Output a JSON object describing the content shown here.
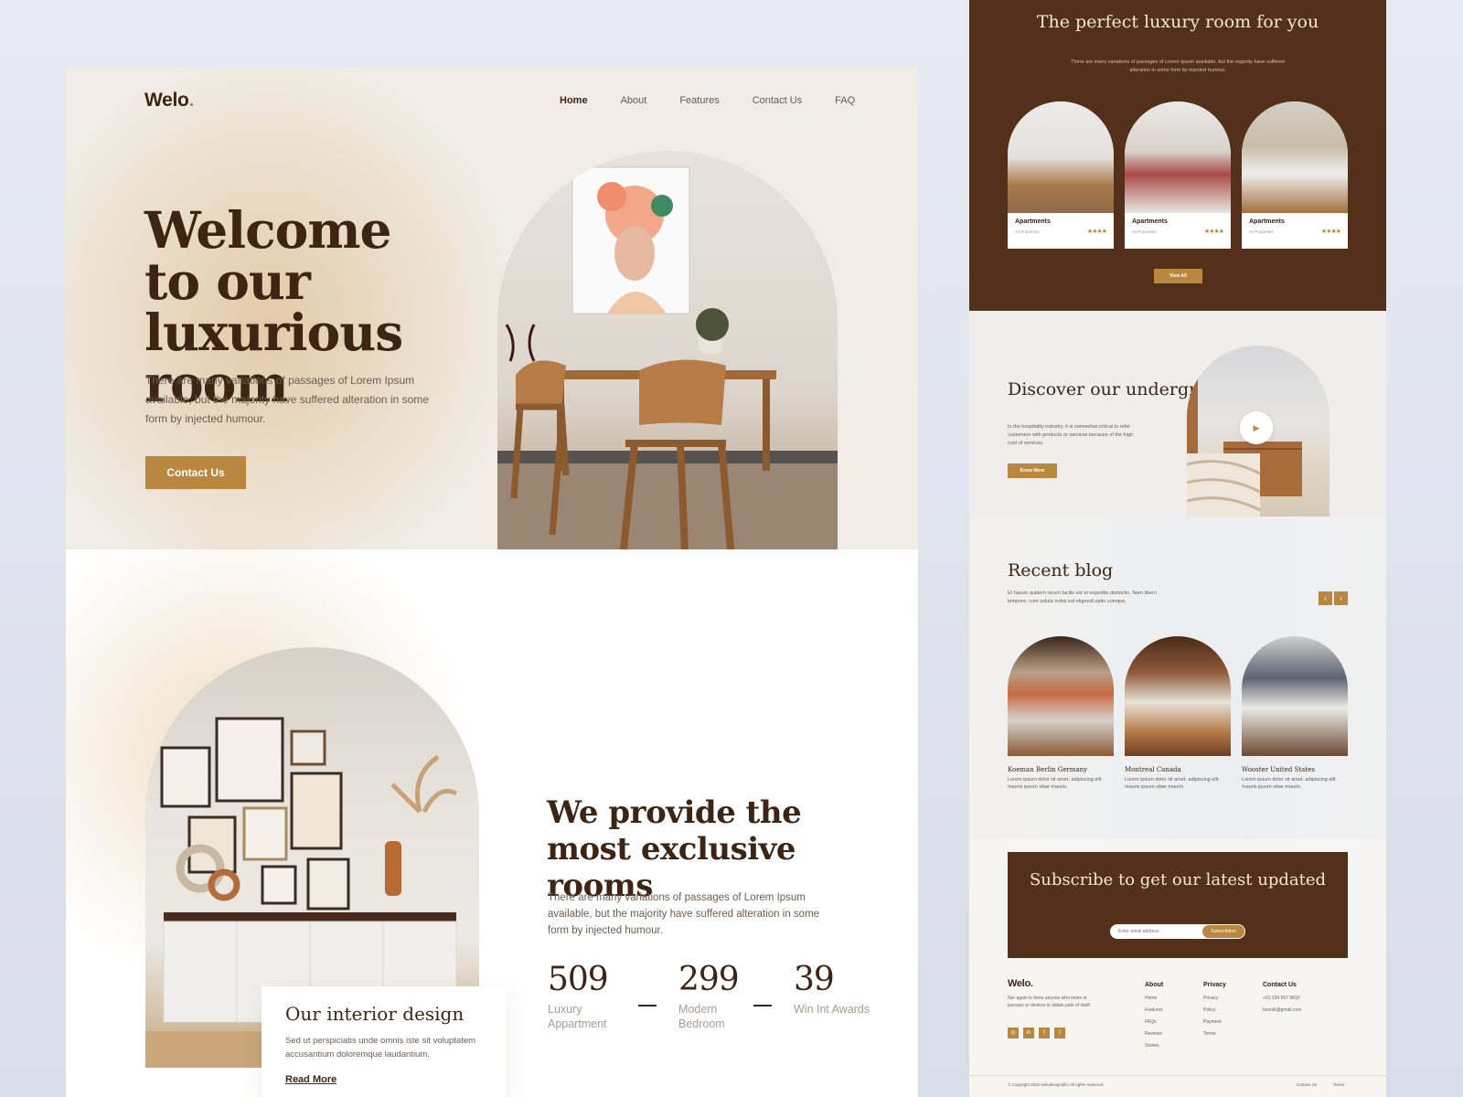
{
  "landing": {
    "logo": "Welo",
    "logo_dot": ".",
    "nav": [
      "Home",
      "About",
      "Features",
      "Contact Us",
      "FAQ"
    ],
    "hero": {
      "title": "Welcome to our luxurious room",
      "description": "There are many variations of passages of Lorem Ipsum available, but the majority have suffered alteration in some form by injected humour.",
      "cta": "Contact Us"
    },
    "about": {
      "title": "We provide the most exclusive rooms",
      "description": "There are many variations of passages of Lorem Ipsum available, but the majority have suffered alteration in some form by injected humour.",
      "card_title": "Our interior design",
      "card_desc": "Sed ut perspiciatis unde omnis iste sit voluptatem accusantium doloremque laudantium.",
      "card_link": "Read More",
      "stats": [
        {
          "number": "509",
          "label": "Luxury Appartment"
        },
        {
          "number": "299",
          "label": "Modern Bedroom"
        },
        {
          "number": "39",
          "label": "Win Int Awards"
        }
      ]
    }
  },
  "detail": {
    "rooms": {
      "title": "The perfect luxury room for you",
      "description": "There are many variations of passages of Lorem Ipsum available, but the majority have suffered alteration in some form by injected humour.",
      "cards": [
        {
          "name": "Apartments",
          "count": "43 Properties",
          "stars": "★★★★"
        },
        {
          "name": "Apartments",
          "count": "43 Properties",
          "stars": "★★★★"
        },
        {
          "name": "Apartments",
          "count": "43 Properties",
          "stars": "★★★★"
        }
      ],
      "button": "View All"
    },
    "discover": {
      "title": "Discover our underground",
      "description": "In the hospitality industry, it is somewhat critical to refer customers with products or services because of the high cost of services.",
      "button": "Know More",
      "play_icon": "▶"
    },
    "blog": {
      "title": "Recent blog",
      "description": "Et harum quidem rerum facilis est et expedita distinctio. Nam libero tempore, cum soluta nobis est eligendi optio cumque.",
      "prev": "‹",
      "next": "›",
      "posts": [
        {
          "location": "Koeman Berlin Germany",
          "text": "Lorem ipsum dolor sit amet, adipiscing elit mauris ipsum vitae mauris."
        },
        {
          "location": "Montreal Canada",
          "text": "Lorem ipsum dolor sit amet, adipiscing elit mauris ipsum vitae mauris."
        },
        {
          "location": "Wooster United States",
          "text": "Lorem ipsum dolor sit amet, adipiscing elit mauris ipsum vitae mauris."
        }
      ]
    },
    "subscribe": {
      "title": "Subscribe to get our latest updated",
      "placeholder": "Enter email address",
      "button": "Subscribtion"
    },
    "footer": {
      "logo": "Welo.",
      "about": "Nor again is there anyone who loves or pursues or desires to obtain pain of itself.",
      "social_icons": [
        "instagram-icon",
        "linkedin-icon",
        "facebook-icon",
        "twitter-icon"
      ],
      "social_glyphs": [
        "◎",
        "in",
        "f",
        "t"
      ],
      "columns": [
        {
          "heading": "About",
          "items": [
            "Home",
            "Features",
            "FAQs",
            "Reviews",
            "Stories"
          ]
        },
        {
          "heading": "Privacy",
          "items": [
            "Privacy",
            "Policy",
            "Payment",
            "Terms"
          ]
        },
        {
          "heading": "Contact Us",
          "items": [
            "+01 234 567 8910",
            "besnik@gmail.com"
          ]
        }
      ],
      "copyright": "© Copyright 2022 welodesign@in.All rights reserved.",
      "bottom_links": [
        "Contact Us",
        "Terms"
      ]
    }
  },
  "colors": {
    "accent": "#b9873f",
    "dark_brown": "#52301a",
    "text_brown": "#3e2412"
  }
}
